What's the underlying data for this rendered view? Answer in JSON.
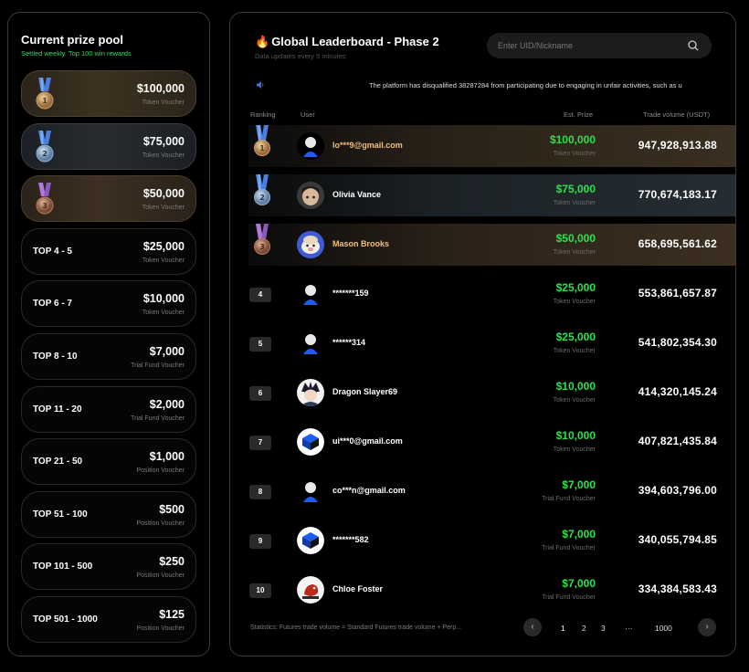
{
  "prize_pool": {
    "title": "Current prize pool",
    "subtitle": "Settled weekly. Top 100 win rewards",
    "items": [
      {
        "rank": "",
        "amount": "$100,000",
        "type": "Token Voucher",
        "medal": "gold"
      },
      {
        "rank": "",
        "amount": "$75,000",
        "type": "Token Voucher",
        "medal": "silver"
      },
      {
        "rank": "",
        "amount": "$50,000",
        "type": "Token Voucher",
        "medal": "bronze"
      },
      {
        "rank": "TOP 4 - 5",
        "amount": "$25,000",
        "type": "Token Voucher"
      },
      {
        "rank": "TOP 6 - 7",
        "amount": "$10,000",
        "type": "Token Voucher"
      },
      {
        "rank": "TOP 8 - 10",
        "amount": "$7,000",
        "type": "Trial Fund Voucher"
      },
      {
        "rank": "TOP 11 - 20",
        "amount": "$2,000",
        "type": "Trial Fund Voucher"
      },
      {
        "rank": "TOP 21 - 50",
        "amount": "$1,000",
        "type": "Position Voucher"
      },
      {
        "rank": "TOP 51 - 100",
        "amount": "$500",
        "type": "Position Voucher"
      },
      {
        "rank": "TOP 101 - 500",
        "amount": "$250",
        "type": "Position Voucher"
      },
      {
        "rank": "TOP 501 - 1000",
        "amount": "$125",
        "type": "Position Voucher"
      }
    ]
  },
  "leaderboard": {
    "flame": "🔥",
    "title": "Global Leaderboard - Phase 2",
    "subtitle": "Data updates every 5 minutes",
    "search_placeholder": "Enter UID/Nickname",
    "announcement": "The platform has disqualified 38287284 from participating due to engaging in unfair activities, such as u",
    "columns": {
      "ranking": "Ranking",
      "user": "User",
      "prize": "Est. Prize",
      "volume": "Trade volume (USDT)"
    },
    "rows": [
      {
        "rank": "1",
        "user": "lo***9@gmail.com",
        "prize": "$100,000",
        "prize_type": "Token Voucher",
        "volume": "947,928,913.88"
      },
      {
        "rank": "2",
        "user": "Olivia Vance",
        "prize": "$75,000",
        "prize_type": "Token Voucher",
        "volume": "770,674,183.17"
      },
      {
        "rank": "3",
        "user": "Mason Brooks",
        "prize": "$50,000",
        "prize_type": "Token Voucher",
        "volume": "658,695,561.62"
      },
      {
        "rank": "4",
        "user": "*******159",
        "prize": "$25,000",
        "prize_type": "Token Voucher",
        "volume": "553,861,657.87"
      },
      {
        "rank": "5",
        "user": "******314",
        "prize": "$25,000",
        "prize_type": "Token Voucher",
        "volume": "541,802,354.30"
      },
      {
        "rank": "6",
        "user": "Dragon Slayer69",
        "prize": "$10,000",
        "prize_type": "Token Voucher",
        "volume": "414,320,145.24"
      },
      {
        "rank": "7",
        "user": "ui***0@gmail.com",
        "prize": "$10,000",
        "prize_type": "Token Voucher",
        "volume": "407,821,435.84"
      },
      {
        "rank": "8",
        "user": "co***n@gmail.com",
        "prize": "$7,000",
        "prize_type": "Trial Fund Voucher",
        "volume": "394,603,796.00"
      },
      {
        "rank": "9",
        "user": "*******582",
        "prize": "$7,000",
        "prize_type": "Trial Fund Voucher",
        "volume": "340,055,794.85"
      },
      {
        "rank": "10",
        "user": "Chloe Foster",
        "prize": "$7,000",
        "prize_type": "Trial Fund Voucher",
        "volume": "334,384,583.43"
      }
    ],
    "stats": "Statistics: Futures trade volume = Standard Futures trade volume + Perp...",
    "pagination": {
      "prev": "‹",
      "pages": [
        "1",
        "2",
        "3"
      ],
      "ellipsis": "···",
      "last": "1000",
      "next": "›"
    }
  }
}
